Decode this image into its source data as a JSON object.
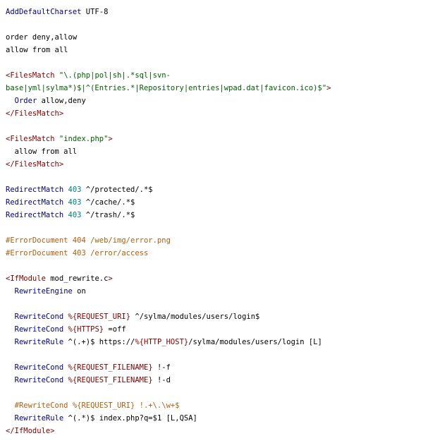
{
  "lines": [
    [
      {
        "t": "AddDefaultCharset",
        "c": "kw"
      },
      {
        "t": " UTF-8",
        "c": "txt"
      }
    ],
    [],
    [
      {
        "t": "order deny,allow",
        "c": "txt"
      }
    ],
    [
      {
        "t": "allow from all",
        "c": "txt"
      }
    ],
    [],
    [
      {
        "t": "<FilesMatch",
        "c": "tag"
      },
      {
        "t": " ",
        "c": "txt"
      },
      {
        "t": "\"\\.(php|pol|sh|.*sql|svn-",
        "c": "str"
      }
    ],
    [
      {
        "t": "base|yml|sylma*)$|^(Entries.*|Repository|entries|wpad.dat|favicon.ico)$\"",
        "c": "str"
      },
      {
        "t": ">",
        "c": "tag"
      }
    ],
    [
      {
        "t": "  ",
        "c": "txt"
      },
      {
        "t": "Order",
        "c": "kw"
      },
      {
        "t": " allow,deny",
        "c": "txt"
      }
    ],
    [
      {
        "t": "</FilesMatch>",
        "c": "tag"
      }
    ],
    [],
    [
      {
        "t": "<FilesMatch",
        "c": "tag"
      },
      {
        "t": " ",
        "c": "txt"
      },
      {
        "t": "\"index.php\"",
        "c": "str"
      },
      {
        "t": ">",
        "c": "tag"
      }
    ],
    [
      {
        "t": "  allow from all",
        "c": "txt"
      }
    ],
    [
      {
        "t": "</FilesMatch>",
        "c": "tag"
      }
    ],
    [],
    [
      {
        "t": "RedirectMatch",
        "c": "kw"
      },
      {
        "t": " ",
        "c": "txt"
      },
      {
        "t": "403",
        "c": "num"
      },
      {
        "t": " ^/protected/.*$",
        "c": "txt"
      }
    ],
    [
      {
        "t": "RedirectMatch",
        "c": "kw"
      },
      {
        "t": " ",
        "c": "txt"
      },
      {
        "t": "403",
        "c": "num"
      },
      {
        "t": " ^/cache/.*$",
        "c": "txt"
      }
    ],
    [
      {
        "t": "RedirectMatch",
        "c": "kw"
      },
      {
        "t": " ",
        "c": "txt"
      },
      {
        "t": "403",
        "c": "num"
      },
      {
        "t": " ^/trash/.*$",
        "c": "txt"
      }
    ],
    [],
    [
      {
        "t": "#ErrorDocument 404 /web/img/error.png",
        "c": "cmt"
      }
    ],
    [
      {
        "t": "#ErrorDocument 403 /error/access",
        "c": "cmt"
      }
    ],
    [],
    [
      {
        "t": "<IfModule",
        "c": "tag"
      },
      {
        "t": " mod_rewrite.c",
        "c": "txt"
      },
      {
        "t": ">",
        "c": "tag"
      }
    ],
    [
      {
        "t": "  ",
        "c": "txt"
      },
      {
        "t": "RewriteEngine",
        "c": "kw"
      },
      {
        "t": " on",
        "c": "txt"
      }
    ],
    [],
    [
      {
        "t": "  ",
        "c": "txt"
      },
      {
        "t": "RewriteCond",
        "c": "kw"
      },
      {
        "t": " ",
        "c": "txt"
      },
      {
        "t": "%{REQUEST_URI}",
        "c": "var"
      },
      {
        "t": " ^/sylma/modules/users/login$",
        "c": "txt"
      }
    ],
    [
      {
        "t": "  ",
        "c": "txt"
      },
      {
        "t": "RewriteCond",
        "c": "kw"
      },
      {
        "t": " ",
        "c": "txt"
      },
      {
        "t": "%{HTTPS}",
        "c": "var"
      },
      {
        "t": " =off",
        "c": "txt"
      }
    ],
    [
      {
        "t": "  ",
        "c": "txt"
      },
      {
        "t": "RewriteRule",
        "c": "kw"
      },
      {
        "t": " ^(.+)$ https://",
        "c": "txt"
      },
      {
        "t": "%{HTTP_HOST}",
        "c": "var"
      },
      {
        "t": "/sylma/modules/users/login [L]",
        "c": "txt"
      }
    ],
    [],
    [
      {
        "t": "  ",
        "c": "txt"
      },
      {
        "t": "RewriteCond",
        "c": "kw"
      },
      {
        "t": " ",
        "c": "txt"
      },
      {
        "t": "%{REQUEST_FILENAME}",
        "c": "var"
      },
      {
        "t": " !-f",
        "c": "txt"
      }
    ],
    [
      {
        "t": "  ",
        "c": "txt"
      },
      {
        "t": "RewriteCond",
        "c": "kw"
      },
      {
        "t": " ",
        "c": "txt"
      },
      {
        "t": "%{REQUEST_FILENAME}",
        "c": "var"
      },
      {
        "t": " !-d",
        "c": "txt"
      }
    ],
    [],
    [
      {
        "t": "  #RewriteCond %{REQUEST_URI} !.+\\.\\w+$",
        "c": "cmt"
      }
    ],
    [
      {
        "t": "  ",
        "c": "txt"
      },
      {
        "t": "RewriteRule",
        "c": "kw"
      },
      {
        "t": " ^(.*)$ index.php?q=$1 [L,QSA]",
        "c": "txt"
      }
    ],
    [
      {
        "t": "</IfModule>",
        "c": "tag"
      }
    ]
  ]
}
